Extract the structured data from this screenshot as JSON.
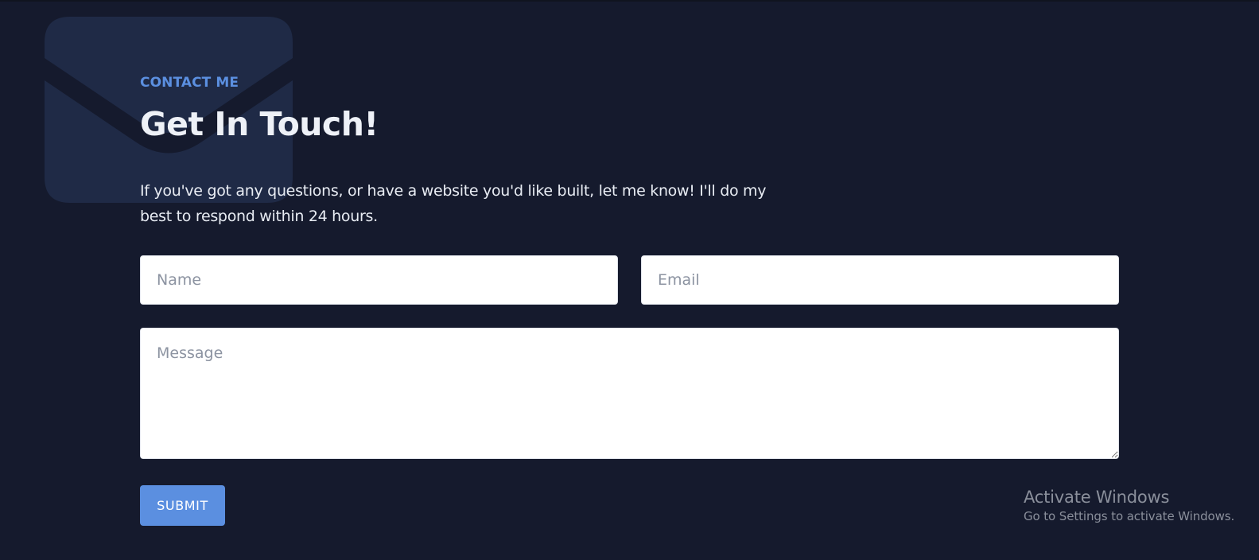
{
  "contact": {
    "eyebrow": "CONTACT ME",
    "title": "Get In Touch!",
    "description": "If you've got any questions, or have a website you'd like built, let me know! I'll do my best to respond within 24 hours.",
    "background_icon": "envelope-icon"
  },
  "form": {
    "name_placeholder": "Name",
    "email_placeholder": "Email",
    "message_placeholder": "Message",
    "submit_label": "SUBMIT"
  },
  "watermark": {
    "title": "Activate Windows",
    "subtitle": "Go to Settings to activate Windows."
  },
  "colors": {
    "background": "#151a2d",
    "accent": "#5b8fe0",
    "heading": "#eef1f7",
    "envelope": "#1f2a46"
  }
}
